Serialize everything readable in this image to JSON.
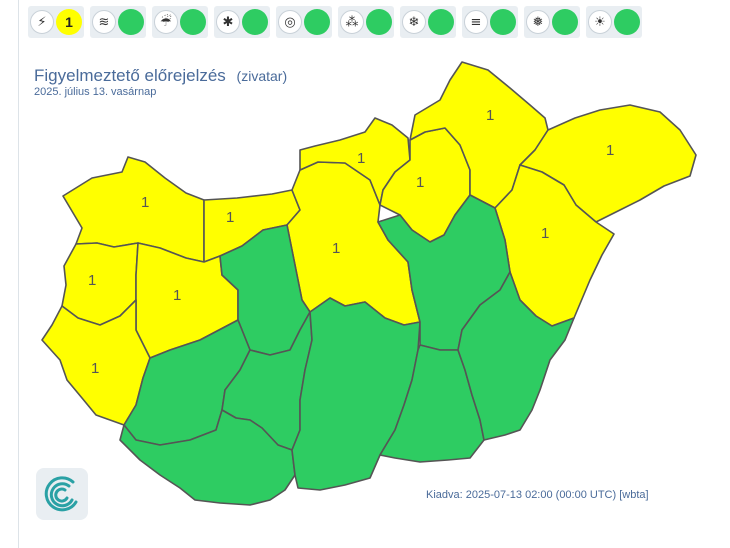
{
  "toolbar": [
    {
      "icon": "lightning-icon",
      "glyph": "⚡",
      "value": "1",
      "color": "#ffff00"
    },
    {
      "icon": "wind-icon",
      "glyph": "≋",
      "value": "",
      "color": "#2ecc62"
    },
    {
      "icon": "rain-icon",
      "glyph": "☔",
      "value": "",
      "color": "#2ecc62"
    },
    {
      "icon": "snowdrift-icon",
      "glyph": "✱",
      "value": "",
      "color": "#2ecc62"
    },
    {
      "icon": "freezing-rain-icon",
      "glyph": "◎",
      "value": "",
      "color": "#2ecc62"
    },
    {
      "icon": "heavy-rain-icon",
      "glyph": "⁂",
      "value": "",
      "color": "#2ecc62"
    },
    {
      "icon": "snow-icon",
      "glyph": "❄",
      "value": "",
      "color": "#2ecc62"
    },
    {
      "icon": "fog-icon",
      "glyph": "≡",
      "value": "",
      "color": "#2ecc62"
    },
    {
      "icon": "cold-icon",
      "glyph": "❅",
      "value": "",
      "color": "#2ecc62"
    },
    {
      "icon": "heat-icon",
      "glyph": "☀",
      "value": "",
      "color": "#2ecc62"
    }
  ],
  "header": {
    "title": "Figyelmeztető előrejelzés",
    "subtitle": "(zivatar)",
    "date": "2025. július 13. vasárnap"
  },
  "footer": {
    "issued": "Kiadva: 2025-07-13 02:00 (00:00 UTC) [wbta]"
  },
  "colors": {
    "level1": "#ffff00",
    "level0": "#2ecc62",
    "text": "#4a6b9a",
    "logo": "#2aa1a5"
  },
  "regions": [
    {
      "name": "gyor-moson-sopron",
      "level": 1,
      "label": "1"
    },
    {
      "name": "komarom-esztergom",
      "level": 1,
      "label": "1"
    },
    {
      "name": "vas",
      "level": 1,
      "label": "1"
    },
    {
      "name": "veszprem",
      "level": 1,
      "label": "1"
    },
    {
      "name": "zala",
      "level": 1,
      "label": "1"
    },
    {
      "name": "pest",
      "level": 1,
      "label": "1"
    },
    {
      "name": "nograd",
      "level": 1,
      "label": "1"
    },
    {
      "name": "heves",
      "level": 1,
      "label": "1"
    },
    {
      "name": "borsod-abauj-zemplen",
      "level": 1,
      "label": "1"
    },
    {
      "name": "szabolcs-szatmar-bereg",
      "level": 1,
      "label": "1"
    },
    {
      "name": "hajdu-bihar",
      "level": 1,
      "label": "1"
    },
    {
      "name": "fejer",
      "level": 0,
      "label": ""
    },
    {
      "name": "somogy",
      "level": 0,
      "label": ""
    },
    {
      "name": "tolna",
      "level": 0,
      "label": ""
    },
    {
      "name": "baranya",
      "level": 0,
      "label": ""
    },
    {
      "name": "bacs-kiskun",
      "level": 0,
      "label": ""
    },
    {
      "name": "jasz-nagykun-szolnok",
      "level": 0,
      "label": ""
    },
    {
      "name": "csongrad-csanad",
      "level": 0,
      "label": ""
    },
    {
      "name": "bekes",
      "level": 0,
      "label": ""
    }
  ]
}
